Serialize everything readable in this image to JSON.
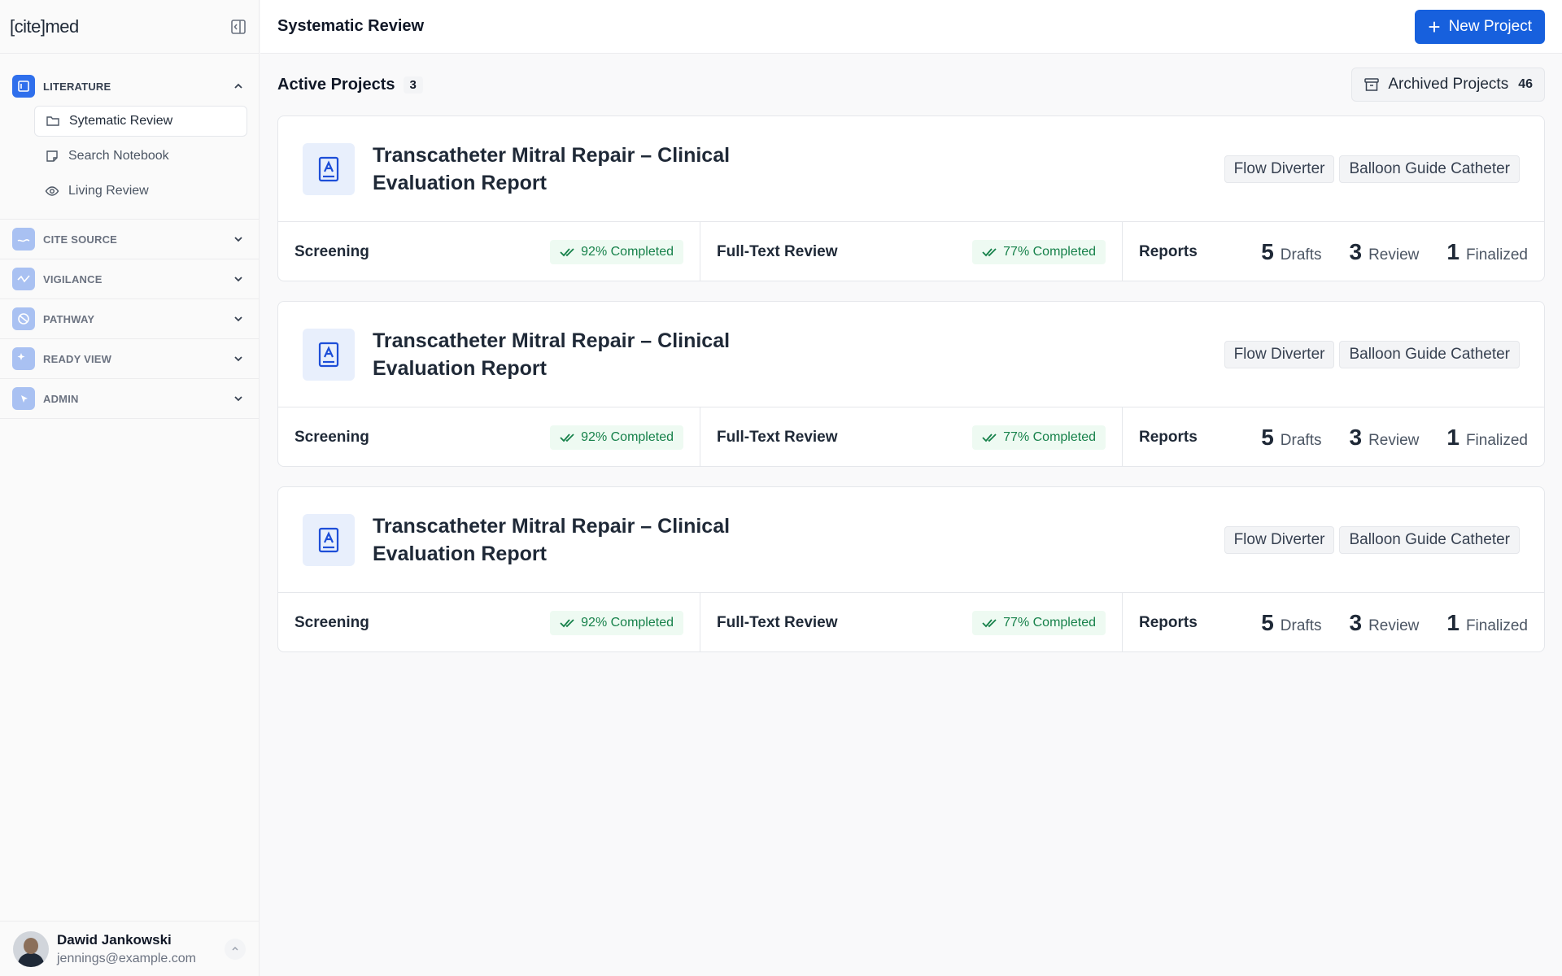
{
  "app": {
    "logo": "[cite]med"
  },
  "sidebar": {
    "sections": [
      {
        "label": "LITERATURE",
        "icon": "literature-icon",
        "expanded": true,
        "items": [
          {
            "label": "Sytematic Review",
            "icon": "folder-icon",
            "selected": true
          },
          {
            "label": "Search Notebook",
            "icon": "notebook-icon",
            "selected": false
          },
          {
            "label": "Living Review",
            "icon": "eye-icon",
            "selected": false
          }
        ]
      },
      {
        "label": "CITE SOURCE",
        "icon": "cite-source-icon",
        "expanded": false
      },
      {
        "label": "VIGILANCE",
        "icon": "vigilance-icon",
        "expanded": false
      },
      {
        "label": "PATHWAY",
        "icon": "pathway-icon",
        "expanded": false
      },
      {
        "label": "READY VIEW",
        "icon": "ready-view-icon",
        "expanded": false
      },
      {
        "label": "ADMIN",
        "icon": "admin-icon",
        "expanded": false
      }
    ]
  },
  "user": {
    "name": "Dawid Jankowski",
    "email": "jennings@example.com"
  },
  "header": {
    "title": "Systematic Review",
    "new_project_label": "New Project"
  },
  "list": {
    "title": "Active Projects",
    "count": "3",
    "archived_label": "Archived Projects",
    "archived_count": "46"
  },
  "projects": [
    {
      "title": "Transcatheter Mitral Repair – Clinical Evaluation Report",
      "tags": [
        "Flow Diverter",
        "Balloon Guide Catheter"
      ],
      "screening_label": "Screening",
      "screening_progress": "92% Completed",
      "fulltext_label": "Full-Text Review",
      "fulltext_progress": "77% Completed",
      "reports_label": "Reports",
      "drafts": "5",
      "drafts_label": "Drafts",
      "review": "3",
      "review_label": "Review",
      "finalized": "1",
      "finalized_label": "Finalized"
    },
    {
      "title": "Transcatheter Mitral Repair – Clinical Evaluation Report",
      "tags": [
        "Flow Diverter",
        "Balloon Guide Catheter"
      ],
      "screening_label": "Screening",
      "screening_progress": "92% Completed",
      "fulltext_label": "Full-Text Review",
      "fulltext_progress": "77% Completed",
      "reports_label": "Reports",
      "drafts": "5",
      "drafts_label": "Drafts",
      "review": "3",
      "review_label": "Review",
      "finalized": "1",
      "finalized_label": "Finalized"
    },
    {
      "title": "Transcatheter Mitral Repair – Clinical Evaluation Report",
      "tags": [
        "Flow Diverter",
        "Balloon Guide Catheter"
      ],
      "screening_label": "Screening",
      "screening_progress": "92% Completed",
      "fulltext_label": "Full-Text Review",
      "fulltext_progress": "77% Completed",
      "reports_label": "Reports",
      "drafts": "5",
      "drafts_label": "Drafts",
      "review": "3",
      "review_label": "Review",
      "finalized": "1",
      "finalized_label": "Finalized"
    }
  ],
  "colors": {
    "accent": "#1760dd",
    "success": "#16814a",
    "success_bg": "#eefaf2"
  }
}
